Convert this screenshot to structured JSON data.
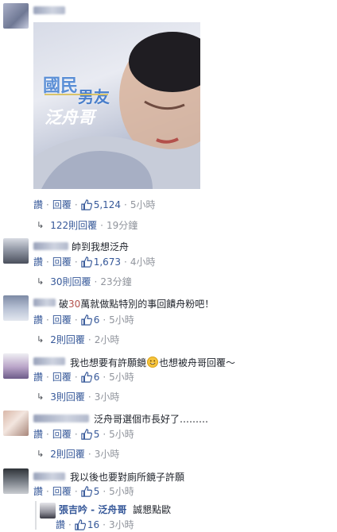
{
  "post_comment": {
    "photo": {
      "overlay_line1": "國民",
      "overlay_line2": "男友",
      "overlay_line3": "泛舟哥"
    },
    "like_label": "讚",
    "reply_label": "回覆",
    "like_count": "5,124",
    "time": "5小時",
    "replies_label": "122則回覆",
    "replies_time": "19分鐘"
  },
  "comments": [
    {
      "text": "帥到我想泛舟",
      "like_label": "讚",
      "reply_label": "回覆",
      "like_count": "1,673",
      "time": "4小時",
      "replies_label": "30則回覆",
      "replies_time": "23分鐘"
    },
    {
      "text_a": "破",
      "text_num": "30",
      "text_b": "萬就做點特別的事回饋舟粉吧！",
      "like_label": "讚",
      "reply_label": "回覆",
      "like_count": "6",
      "time": "5小時",
      "replies_label": "2則回覆",
      "replies_time": "2小時"
    },
    {
      "text_a": "我也想要有許願鏡",
      "text_b": "也想被舟哥回覆～",
      "like_label": "讚",
      "reply_label": "回覆",
      "like_count": "6",
      "time": "5小時",
      "replies_label": "3則回覆",
      "replies_time": "3小時"
    },
    {
      "text": "泛舟哥選個市長好了………",
      "like_label": "讚",
      "reply_label": "回覆",
      "like_count": "5",
      "time": "5小時",
      "replies_label": "2則回覆",
      "replies_time": "3小時"
    },
    {
      "text": "我以後也要對廁所鏡子許願",
      "like_label": "讚",
      "reply_label": "回覆",
      "like_count": "5",
      "time": "5小時"
    }
  ],
  "reply": {
    "author": "張吉吟 - 泛舟哥",
    "text": "誠懇點歐",
    "like_label": "讚",
    "like_count": "16",
    "time": "3小時"
  },
  "colors": {
    "link": "#365899",
    "meta": "#90949c",
    "text": "#1d2129",
    "overlay_blue": "#5b8fd6",
    "overlay_text": "#ffffff"
  },
  "icons": [
    "thumbs-up-icon",
    "reply-arrow-icon",
    "smile-emoji-icon"
  ]
}
